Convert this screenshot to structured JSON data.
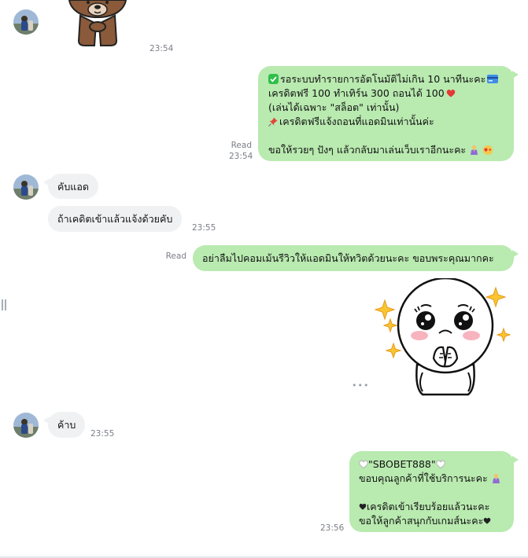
{
  "colors": {
    "outgoing_bubble": "#b9eab0",
    "incoming_bubble": "#f0f1f3",
    "meta_text": "#7b7f86",
    "check_green": "#2fbf4a",
    "card_blue": "#3e8ee8",
    "heart_red": "#e53935",
    "pin_red": "#e2463b"
  },
  "messages": {
    "m0": {
      "time": "23:54",
      "sticker": "brown-bear-sticker"
    },
    "m1": {
      "read": "Read",
      "time": "23:54",
      "line1_icon": "check-box-icon",
      "line1": "รอระบบทำรายการอัตโนมัติไม่เกิน 10 นาทีนะคะ",
      "line1_end_icon": "credit-card-icon",
      "line2": "เครดิตฟรี 100 ทำเทิร์น 300 ถอนได้ 100",
      "line2_end_icon": "red-heart-icon",
      "line3": "(เล่นได้เฉพาะ \"สล็อต\" เท่านั้น)",
      "line4_icon": "pushpin-icon",
      "line4": "เครดิตฟรีแจ้งถอนที่แอดมินเท่านั้นค่ะ",
      "line5": "ขอให้รวยๆ ปังๆ แล้วกลับมาเล่นเว็บเราอีกนะคะ",
      "line5_end_icons": "praying-woman-icon, hearts-icon"
    },
    "m2": {
      "text": "คับแอด"
    },
    "m3": {
      "text": "ถ้าเคดิตเข้าแล้วแจ้งด้วยคับ",
      "time": "23:55"
    },
    "m4": {
      "read": "Read",
      "text": "อย่าลืมไปคอมเม้นรีวิวให้แอดมินให้ทวิตด้วยนะคะ ขอบพระคุณมากคะ"
    },
    "m5": {
      "sticker": "moon-character-sparkle-sticker"
    },
    "m6": {
      "text": "ค้าบ",
      "time": "23:55"
    },
    "m7": {
      "time": "23:56",
      "line1": "\"SBOBET888\"",
      "line1_icons": "white-heart-icon",
      "line2": "ขอบคุณลูกค้าที่ใช้บริการนะคะ",
      "line2_end_icon": "praying-woman-icon",
      "line3": "เครดิตเข้าเรียบร้อยแล้วนะคะ",
      "line3_start_icon": "black-heart-icon",
      "line4": "ขอให้ลูกค้าสนุกกับเกมส์นะคะ",
      "line4_end_icon": "black-heart-icon"
    }
  },
  "more_indicator": "•••"
}
